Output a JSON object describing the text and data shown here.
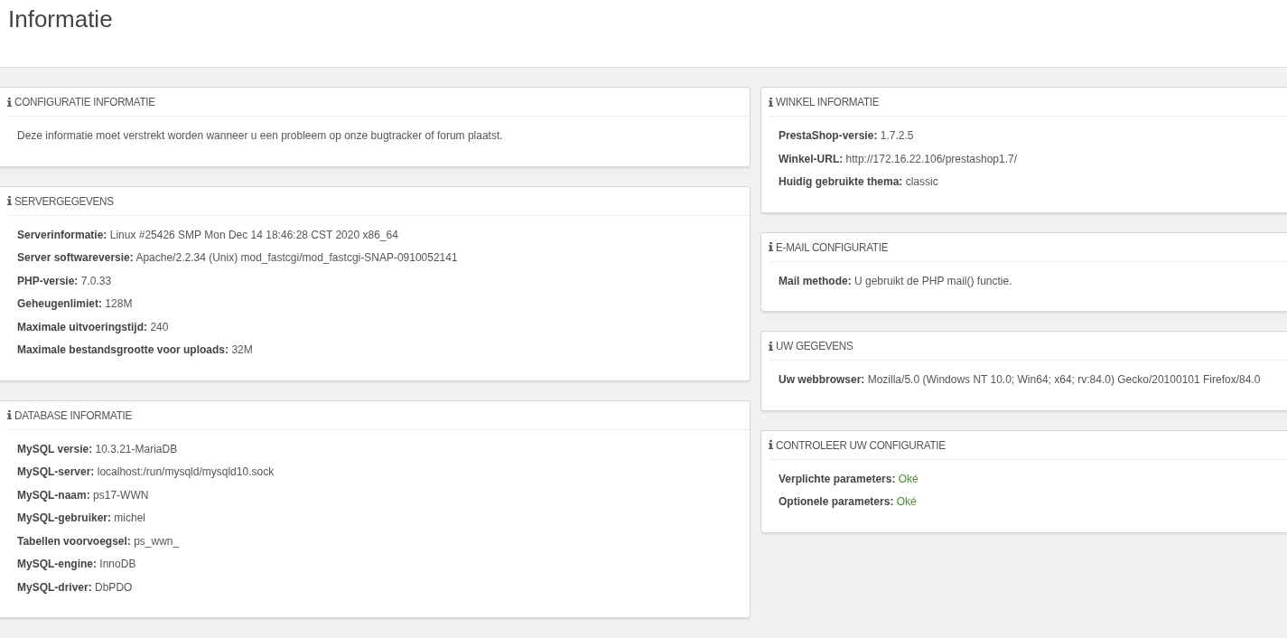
{
  "page_title": "Informatie",
  "columns": [
    {
      "panels": [
        {
          "title": "CONFIGURATIE INFORMATIE",
          "text": "Deze informatie moet verstrekt worden wanneer u een probleem op onze bugtracker of forum plaatst."
        },
        {
          "title": "SERVERGEGEVENS",
          "rows": [
            {
              "label": "Serverinformatie:",
              "value": "Linux #25426 SMP Mon Dec 14 18:46:28 CST 2020 x86_64",
              "kind": "text"
            },
            {
              "label": "Server softwareversie:",
              "value": "Apache/2.2.34 (Unix) mod_fastcgi/mod_fastcgi-SNAP-0910052141",
              "kind": "text"
            },
            {
              "label": "PHP-versie:",
              "value": "7.0.33",
              "kind": "text"
            },
            {
              "label": "Geheugenlimiet:",
              "value": "128M",
              "kind": "text"
            },
            {
              "label": "Maximale uitvoeringstijd:",
              "value": "240",
              "kind": "text"
            },
            {
              "label": "Maximale bestandsgrootte voor uploads:",
              "value": "32M",
              "kind": "text"
            }
          ]
        },
        {
          "title": "DATABASE INFORMATIE",
          "rows": [
            {
              "label": "MySQL versie:",
              "value": "10.3.21-MariaDB",
              "kind": "text"
            },
            {
              "label": "MySQL-server:",
              "value": "localhost:/run/mysqld/mysqld10.sock",
              "kind": "text"
            },
            {
              "label": "MySQL-naam:",
              "value": "ps17-WWN",
              "kind": "text"
            },
            {
              "label": "MySQL-gebruiker:",
              "value": "michel",
              "kind": "text"
            },
            {
              "label": "Tabellen voorvoegsel:",
              "value": "ps_wwn_",
              "kind": "text"
            },
            {
              "label": "MySQL-engine:",
              "value": "InnoDB",
              "kind": "text"
            },
            {
              "label": "MySQL-driver:",
              "value": "DbPDO",
              "kind": "text"
            }
          ]
        }
      ]
    },
    {
      "panels": [
        {
          "title": "WINKEL INFORMATIE",
          "rows": [
            {
              "label": "PrestaShop-versie:",
              "value": "1.7.2.5",
              "kind": "text"
            },
            {
              "label": "Winkel-URL:",
              "value": "http://172.16.22.106/prestashop1.7/",
              "kind": "text"
            },
            {
              "label": "Huidig gebruikte thema:",
              "value": "classic",
              "kind": "text"
            }
          ]
        },
        {
          "title": "E-MAIL CONFIGURATIE",
          "rows": [
            {
              "label": "Mail methode:",
              "value": "U gebruikt de PHP mail() functie.",
              "kind": "text"
            }
          ]
        },
        {
          "title": "UW GEGEVENS",
          "rows": [
            {
              "label": "Uw webbrowser:",
              "value": "Mozilla/5.0 (Windows NT 10.0; Win64; x64; rv:84.0) Gecko/20100101 Firefox/84.0",
              "kind": "text"
            }
          ]
        },
        {
          "title": "CONTROLEER UW CONFIGURATIE",
          "rows": [
            {
              "label": "Verplichte parameters:",
              "value": "Oké",
              "kind": "ok"
            },
            {
              "label": "Optionele parameters:",
              "value": "Oké",
              "kind": "ok"
            }
          ]
        }
      ]
    }
  ]
}
